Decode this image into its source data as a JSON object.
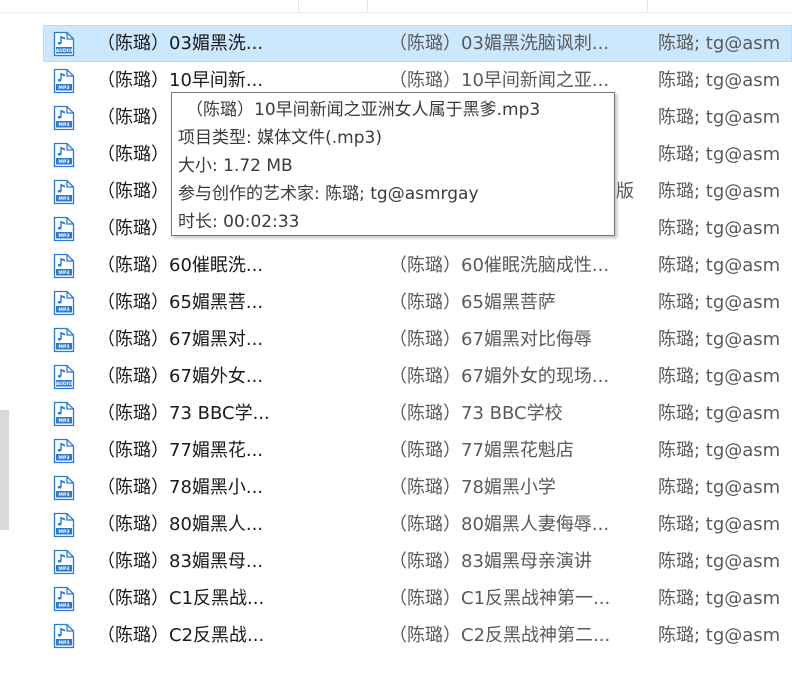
{
  "files": [
    {
      "icon": "audio-file-icon",
      "badge": "AUDIO",
      "name": "（陈璐）03媚黑洗...",
      "title": "（陈璐）03媚黑洗脑讽刺...",
      "artist": "陈璐; tg@asm",
      "selected": true
    },
    {
      "icon": "mp3-file-icon",
      "badge": "MP3",
      "name": "（陈璐）10早间新...",
      "title": "（陈璐）10早间新闻之亚...",
      "artist": "陈璐; tg@asm"
    },
    {
      "icon": "mp3-file-icon",
      "badge": "MP3",
      "name": "（陈璐）",
      "title": "（陈璐）",
      "artist": "陈璐; tg@asm"
    },
    {
      "icon": "mp3-file-icon",
      "badge": "MP3",
      "name": "（陈璐）",
      "title": "（陈璐）",
      "artist": "陈璐; tg@asm"
    },
    {
      "icon": "mp3-file-icon",
      "badge": "MP3",
      "name": "（陈璐）",
      "title": "（陈璐）",
      "artist": "陈璐; tg@asm"
    },
    {
      "icon": "mp3-file-icon",
      "badge": "MP3",
      "name": "（陈璐）",
      "title": "（陈璐）",
      "artist": "陈璐; tg@asm"
    },
    {
      "icon": "mp3-file-icon",
      "badge": "MP3",
      "name": "（陈璐）60催眠洗...",
      "title": "（陈璐）60催眠洗脑成性...",
      "artist": "陈璐; tg@asm"
    },
    {
      "icon": "mp3-file-icon",
      "badge": "MP3",
      "name": "（陈璐）65媚黑菩...",
      "title": "（陈璐）65媚黑菩萨",
      "artist": "陈璐; tg@asm"
    },
    {
      "icon": "mp3-file-icon",
      "badge": "MP3",
      "name": "（陈璐）67媚黑对...",
      "title": "（陈璐）67媚黑对比侮辱",
      "artist": "陈璐; tg@asm"
    },
    {
      "icon": "audio-file-icon",
      "badge": "AUDIO",
      "name": "（陈璐）67媚外女...",
      "title": "（陈璐）67媚外女的现场...",
      "artist": "陈璐; tg@asm"
    },
    {
      "icon": "mp3-file-icon",
      "badge": "MP3",
      "name": "（陈璐）73 BBC学...",
      "title": "（陈璐）73 BBC学校",
      "artist": "陈璐; tg@asm"
    },
    {
      "icon": "mp3-file-icon",
      "badge": "MP3",
      "name": "（陈璐）77媚黑花...",
      "title": "（陈璐）77媚黑花魁店",
      "artist": "陈璐; tg@asm"
    },
    {
      "icon": "mp3-file-icon",
      "badge": "MP3",
      "name": "（陈璐）78媚黑小...",
      "title": "（陈璐）78媚黑小学",
      "artist": "陈璐; tg@asm"
    },
    {
      "icon": "mp3-file-icon",
      "badge": "MP3",
      "name": "（陈璐）80媚黑人...",
      "title": "（陈璐）80媚黑人妻侮辱...",
      "artist": "陈璐; tg@asm"
    },
    {
      "icon": "mp3-file-icon",
      "badge": "MP3",
      "name": "（陈璐）83媚黑母...",
      "title": "（陈璐）83媚黑母亲演讲",
      "artist": "陈璐; tg@asm"
    },
    {
      "icon": "mp3-file-icon",
      "badge": "MP3",
      "name": "（陈璐）C1反黑战...",
      "title": "（陈璐）C1反黑战神第一...",
      "artist": "陈璐; tg@asm"
    },
    {
      "icon": "mp3-file-icon",
      "badge": "MP3",
      "name": "（陈璐）C2反黑战...",
      "title": "（陈璐）C2反黑战神第二...",
      "artist": "陈璐; tg@asm"
    }
  ],
  "tooltip": {
    "lines": [
      "（陈璐）10早间新闻之亚洲女人属于黑爹.mp3",
      "项目类型: 媒体文件(.mp3)",
      "大小: 1.72 MB",
      "参与创作的艺术家: 陈璐; tg@asmrgay",
      "时长: 00:02:33"
    ],
    "peek_text": "版"
  },
  "colors": {
    "selected_bg": "#cce8ff",
    "icon_blue": "#2b79d6"
  }
}
